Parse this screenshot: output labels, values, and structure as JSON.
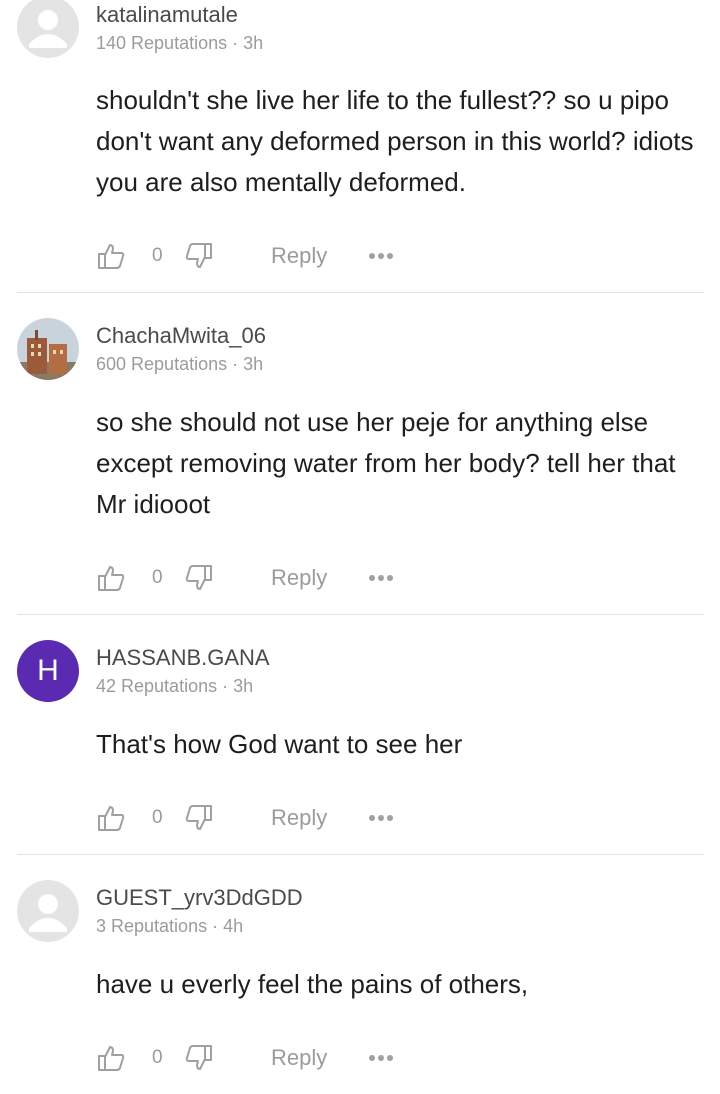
{
  "comments": [
    {
      "username": "katalinamutale",
      "reputations": "140 Reputations",
      "time": "3h",
      "avatar": "default-user-icon",
      "text": "shouldn't she live her life to the fullest?? so u pipo don't want any deformed person in this world? idiots you are also mentally deformed.",
      "likes": "0",
      "reply_label": "Reply"
    },
    {
      "username": "ChachaMwita_06",
      "reputations": "600 Reputations",
      "time": "3h",
      "avatar": "photo-building",
      "text": "so she should not use her peje for anything else except removing water from her body? tell her that Mr idiooot",
      "likes": "0",
      "reply_label": "Reply"
    },
    {
      "username": "HASSANB.GANA",
      "reputations": "42 Reputations",
      "time": "3h",
      "avatar_letter": "H",
      "avatar_color": "#5a2bb0",
      "text": "That's how God want to see her",
      "likes": "0",
      "reply_label": "Reply"
    },
    {
      "username": "GUEST_yrv3DdGDD",
      "reputations": "3 Reputations",
      "time": "4h",
      "avatar": "default-user-icon",
      "text": "have u everly feel the pains of others,",
      "likes": "0",
      "reply_label": "Reply"
    }
  ],
  "meta_separator": "·",
  "colors": {
    "muted": "#9b9b9b",
    "divider": "#e3e3e3",
    "avatar_purple": "#5a2bb0"
  }
}
